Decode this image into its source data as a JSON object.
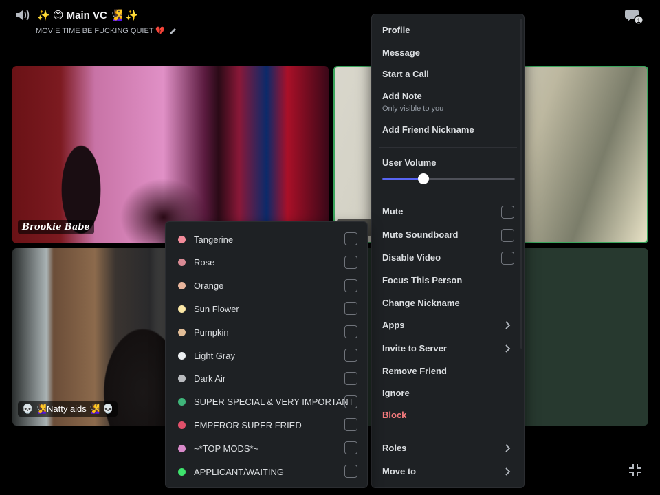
{
  "header": {
    "title": "✨ 😊 Main VC 🧏‍♀️ ✨",
    "subtitle": "MOVIE TIME BE FUCKING QUIET 💔",
    "thread_badge": "1",
    "icons": [
      "speaker-icon",
      "pencil-icon",
      "threads-icon",
      "minimize-icon"
    ]
  },
  "tiles": [
    {
      "name": "Brookie Babe"
    },
    {
      "name": ""
    },
    {
      "name": "💀 🧏‍♀️Natty aids 🧏‍♀️ 💀"
    },
    {
      "name": ""
    }
  ],
  "context_menu": {
    "profile": "Profile",
    "message": "Message",
    "start_call": "Start a Call",
    "add_note": "Add Note",
    "add_note_sub": "Only visible to you",
    "add_friend_nickname": "Add Friend Nickname",
    "user_volume": "User Volume",
    "user_volume_level": 0.31,
    "mute": "Mute",
    "mute_soundboard": "Mute Soundboard",
    "disable_video": "Disable Video",
    "focus": "Focus This Person",
    "change_nickname": "Change Nickname",
    "apps": "Apps",
    "invite": "Invite to Server",
    "remove_friend": "Remove Friend",
    "ignore": "Ignore",
    "block": "Block",
    "roles": "Roles",
    "move_to": "Move to",
    "accent_color": "#5865f2",
    "danger_color": "#f47a7d"
  },
  "roles": [
    {
      "label": "Tangerine",
      "color": "#f28b9a",
      "checked": false
    },
    {
      "label": "Rose",
      "color": "#d98a94",
      "checked": false
    },
    {
      "label": "Orange",
      "color": "#e8b59c",
      "checked": false
    },
    {
      "label": "Sun Flower",
      "color": "#fbe7a6",
      "checked": false
    },
    {
      "label": "Pumpkin",
      "color": "#e1bd97",
      "checked": false
    },
    {
      "label": "Light Gray",
      "color": "#eceff1",
      "checked": false
    },
    {
      "label": "Dark Air",
      "color": "#b9bbbe",
      "checked": false
    },
    {
      "label": "SUPER SPECIAL & VERY IMPORTANT",
      "color": "#3fb57a",
      "checked": false
    },
    {
      "label": "EMPEROR SUPER FRIED",
      "color": "#e0506a",
      "checked": false
    },
    {
      "label": "~*TOP MODS*~",
      "color": "#d889c9",
      "checked": false
    },
    {
      "label": "APPLICANT/WAITING",
      "color": "#3ee36d",
      "checked": false
    }
  ]
}
